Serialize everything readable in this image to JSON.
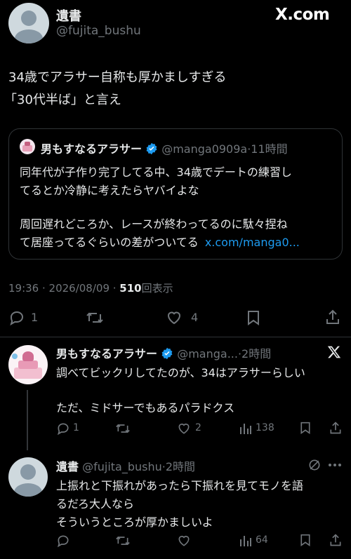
{
  "header": {
    "display_name": "遺書",
    "handle": "@fujita_bushu",
    "brand": "X.com"
  },
  "tweet": {
    "text_line1": "34歳でアラサー自称も厚かましすぎる",
    "text_line2": "「30代半ば」と言え",
    "quote": {
      "name": "男もすなるアラサー",
      "handle": "@manga0909a",
      "time": "·11時間",
      "line1": "同年代が子作り完了してる中、34歳でデートの練習し",
      "line2": "てるとか冷静に考えたらヤバイよな",
      "line3": "周回遅れどころか、レースが終わってるのに駄々捏ね",
      "line4": "て居座ってるぐらいの差がついてる",
      "link": "x.com/manga0..."
    },
    "meta_time": "19:36 · 2026/08/09 · ",
    "views_count": "510",
    "views_label": "回表示",
    "replies": "1",
    "likes": "4"
  },
  "reply1": {
    "name": "男もすなるアラサー",
    "handle": "@manga...",
    "time": "·2時間",
    "line1": "調べてビックリしてたのが、34はアラサーらしい",
    "line2": "ただ、ミドサーでもあるパラドクス",
    "replies": "1",
    "likes": "2",
    "views": "138"
  },
  "reply2": {
    "name": "遺書",
    "handle": "@fujita_bushu",
    "time": "·2時間",
    "line1": "上振れと下振れがあったら下振れを見てモノを語",
    "line2": "るだろ大人なら",
    "line3": "そういうところが厚かましいよ",
    "views": "64"
  },
  "colors": {
    "background": "#000000",
    "text": "#e7e9ea",
    "muted": "#71767b",
    "link": "#1d9bf0",
    "verified": "#1d9bf0",
    "border": "#2f3336"
  }
}
